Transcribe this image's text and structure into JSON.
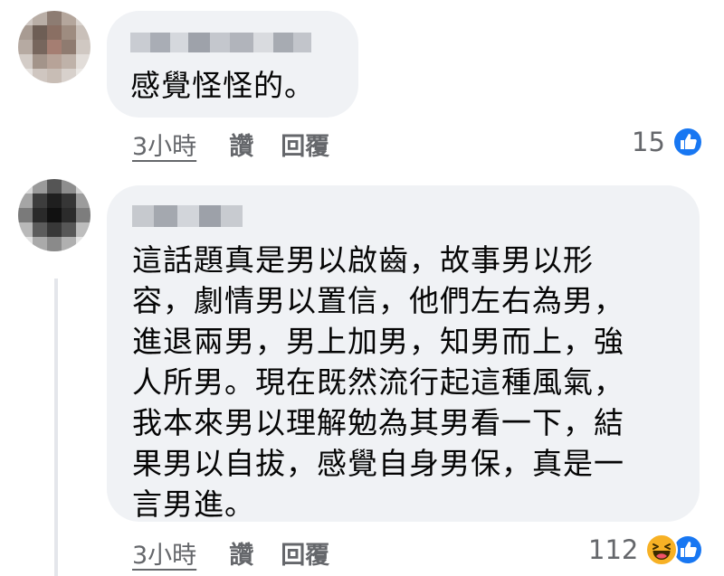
{
  "comments": [
    {
      "text": "感覺怪怪的。",
      "time": "3小時",
      "like_label": "讚",
      "reply_label": "回覆",
      "reaction_count": "15",
      "reactions": [
        "like-icon"
      ]
    },
    {
      "lines": [
        "這話題真是男以啟齒，故事男以形",
        "容，劇情男以置信，他們左右為男，",
        "進退兩男，男上加男，知男而上，強",
        "人所男。現在既然流行起這種風氣，",
        "我本來男以理解勉為其男看一下，結",
        "果男以自拔，感覺自身男保，真是一",
        "言男進。"
      ],
      "time": "3小時",
      "like_label": "讚",
      "reply_label": "回覆",
      "reaction_count": "112",
      "reactions": [
        "haha-icon",
        "like-icon"
      ]
    }
  ],
  "colors": {
    "bubble": "#f0f2f5",
    "meta": "#65676b",
    "like_blue": "#1877f2",
    "haha_yellow": "#f7b125"
  }
}
